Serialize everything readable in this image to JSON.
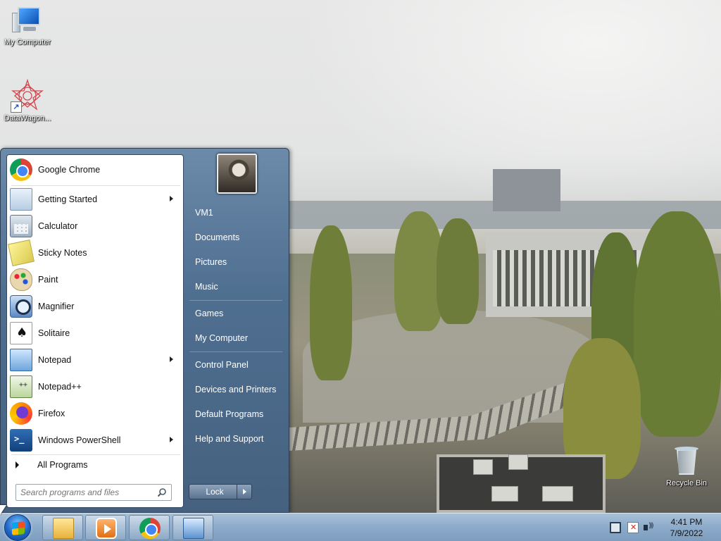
{
  "desktop": {
    "icons": [
      {
        "label": "My Computer",
        "icon": "computer-icon"
      },
      {
        "label": "DataWagon...",
        "icon": "datawagon-icon"
      },
      {
        "label": "Recycle Bin",
        "icon": "recycle-bin-icon"
      }
    ]
  },
  "start_menu": {
    "pinned_programs": [
      {
        "label": "Google Chrome",
        "icon": "chrome-icon",
        "has_submenu": false
      },
      {
        "label": "Getting Started",
        "icon": "getting-started-icon",
        "has_submenu": true
      },
      {
        "label": "Calculator",
        "icon": "calculator-icon",
        "has_submenu": false
      },
      {
        "label": "Sticky Notes",
        "icon": "sticky-notes-icon",
        "has_submenu": false
      },
      {
        "label": "Paint",
        "icon": "paint-icon",
        "has_submenu": false
      },
      {
        "label": "Magnifier",
        "icon": "magnifier-icon",
        "has_submenu": false
      },
      {
        "label": "Solitaire",
        "icon": "solitaire-icon",
        "has_submenu": false
      },
      {
        "label": "Notepad",
        "icon": "notepad-icon",
        "has_submenu": true
      },
      {
        "label": "Notepad++",
        "icon": "notepad-plus-plus-icon",
        "has_submenu": false
      },
      {
        "label": "Firefox",
        "icon": "firefox-icon",
        "has_submenu": false
      },
      {
        "label": "Windows PowerShell",
        "icon": "powershell-icon",
        "has_submenu": true
      }
    ],
    "all_programs_label": "All Programs",
    "search_placeholder": "Search programs and files",
    "right_items": [
      {
        "label": "VM1"
      },
      {
        "label": "Documents"
      },
      {
        "label": "Pictures"
      },
      {
        "label": "Music"
      },
      {
        "label": "Games"
      },
      {
        "label": "My Computer"
      },
      {
        "label": "Control Panel"
      },
      {
        "label": "Devices and Printers"
      },
      {
        "label": "Default Programs"
      },
      {
        "label": "Help and Support"
      }
    ],
    "lock_label": "Lock"
  },
  "taskbar": {
    "pinned": [
      {
        "icon": "windows-explorer-icon"
      },
      {
        "icon": "media-player-icon"
      },
      {
        "icon": "chrome-icon"
      },
      {
        "icon": "remote-desktop-icon"
      }
    ],
    "tray_icons": [
      "network-icon",
      "action-center-icon",
      "volume-icon"
    ],
    "time": "4:41 PM",
    "date": "7/9/2022"
  }
}
